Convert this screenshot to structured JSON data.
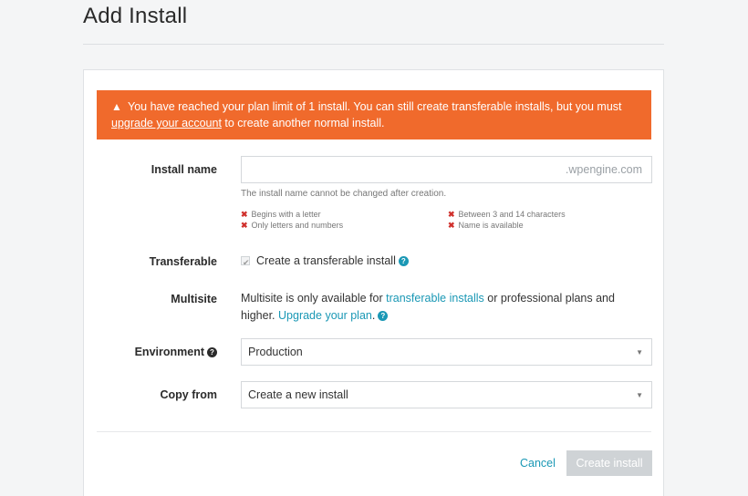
{
  "page": {
    "title": "Add Install"
  },
  "alert": {
    "text_before": "You have reached your plan limit of 1 install. You can still create transferable installs, but you must ",
    "link": "upgrade your account",
    "text_after": " to create another normal install.",
    "color": "#f06a2c"
  },
  "install_name": {
    "label": "Install name",
    "value": "",
    "suffix": ".wpengine.com",
    "hint": "The install name cannot be changed after creation.",
    "rules": [
      {
        "text": "Begins with a letter",
        "status": "fail"
      },
      {
        "text": "Only letters and numbers",
        "status": "fail"
      },
      {
        "text": "Between 3 and 14 characters",
        "status": "fail"
      },
      {
        "text": "Name is available",
        "status": "fail"
      }
    ]
  },
  "transferable": {
    "label": "Transferable",
    "checkbox_label": "Create a transferable install",
    "checked": true,
    "disabled": true,
    "help_icon": "question-circle-icon"
  },
  "multisite": {
    "label": "Multisite",
    "text_1": "Multisite is only available for ",
    "link_1": "transferable installs",
    "text_2": " or professional plans and higher. ",
    "link_2": "Upgrade your plan",
    "text_3": ".",
    "help_icon": "question-circle-icon"
  },
  "environment": {
    "label": "Environment",
    "help_icon": "question-circle-icon",
    "selected": "Production"
  },
  "copy_from": {
    "label": "Copy from",
    "selected": "Create a new install"
  },
  "actions": {
    "cancel": "Cancel",
    "create": "Create install"
  },
  "colors": {
    "accent": "#1a98b5",
    "error": "#d0312d",
    "disabled_button": "#cfd3d6"
  }
}
